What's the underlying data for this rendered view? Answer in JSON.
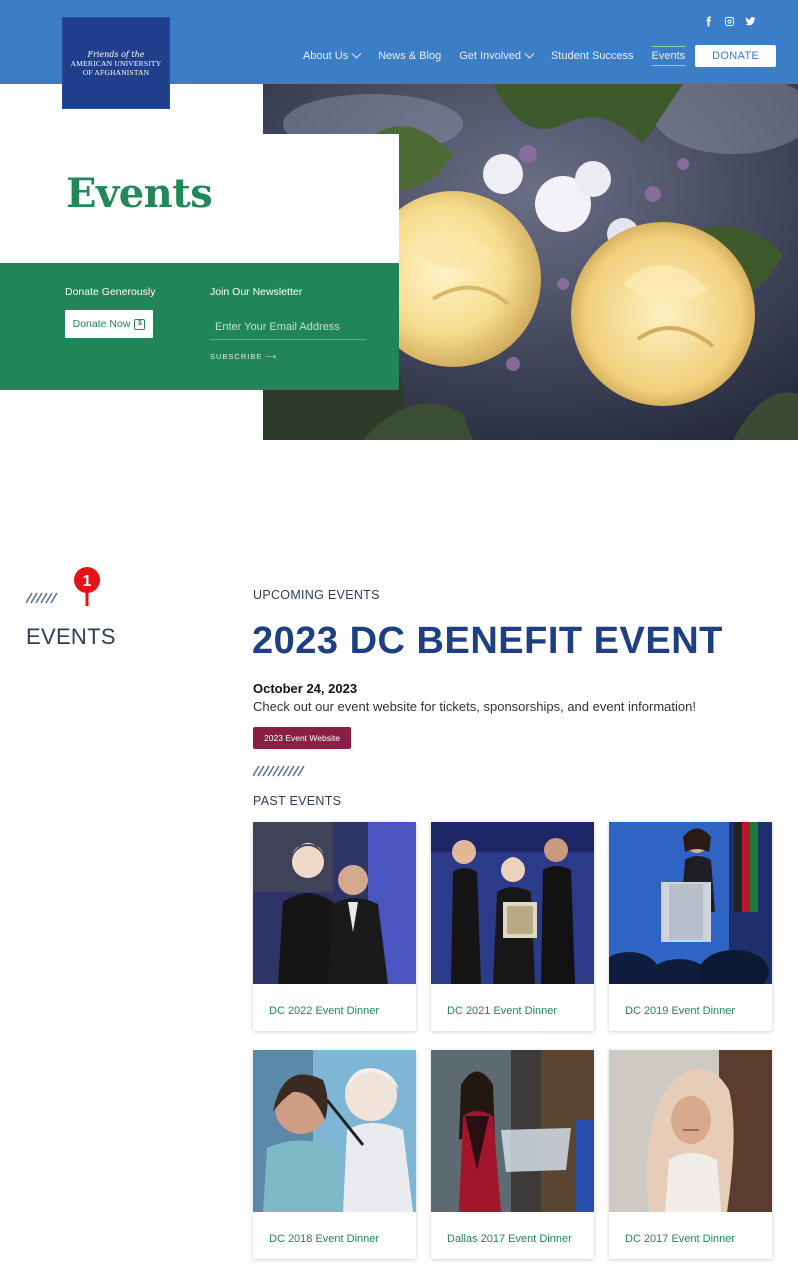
{
  "header": {
    "logo": {
      "line1": "Friends of the",
      "line2": "AMERICAN UNIVERSITY",
      "line3": "OF AFGHANISTAN"
    },
    "nav": [
      {
        "label": "About Us",
        "dropdown": true
      },
      {
        "label": "News & Blog",
        "dropdown": false
      },
      {
        "label": "Get Involved",
        "dropdown": true
      },
      {
        "label": "Student Success",
        "dropdown": false
      },
      {
        "label": "Events",
        "dropdown": false,
        "active": true
      }
    ],
    "donate_label": "DONATE",
    "social": [
      "facebook-icon",
      "instagram-icon",
      "twitter-icon"
    ]
  },
  "hero": {
    "title": "Events",
    "donate_heading": "Donate Generously",
    "donate_button": "Donate Now",
    "newsletter_heading": "Join Our Newsletter",
    "email_placeholder": "Enter Your Email Address",
    "subscribe_label": "SUBSCRIBE ⟶"
  },
  "sidebar": {
    "title": "EVENTS",
    "marker_number": "1"
  },
  "upcoming": {
    "section_label": "UPCOMING EVENTS",
    "title": "2023 DC BENEFIT EVENT",
    "date": "October 24, 2023",
    "description": "Check out our event website for tickets, sponsorships, and event information!",
    "button_label": "2023 Event Website"
  },
  "past": {
    "section_label": "PAST EVENTS",
    "events": [
      {
        "caption": "DC 2022 Event Dinner"
      },
      {
        "caption": "DC 2021 Event Dinner"
      },
      {
        "caption": "DC 2019 Event Dinner"
      },
      {
        "caption": "DC 2018 Event Dinner"
      },
      {
        "caption": "Dallas 2017 Event Dinner"
      },
      {
        "caption": "DC 2017 Event Dinner"
      }
    ]
  },
  "colors": {
    "header_blue": "#3b7dc7",
    "logo_navy": "#1f3e8c",
    "brand_green": "#218657",
    "title_navy": "#1e3f82",
    "button_maroon": "#8a1e44"
  }
}
